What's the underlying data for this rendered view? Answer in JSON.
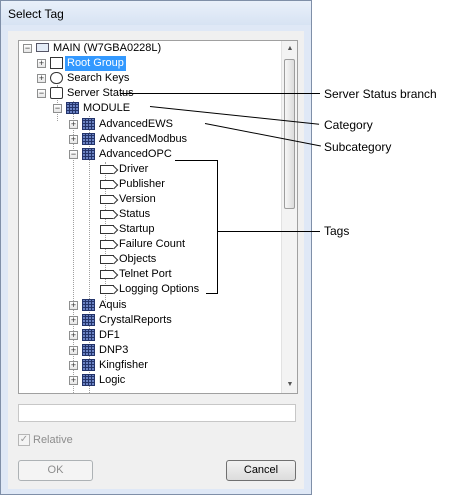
{
  "dialog": {
    "title": "Select Tag",
    "relative_label": "Relative",
    "relative_checked": true,
    "ok_label": "OK",
    "cancel_label": "Cancel"
  },
  "tree": {
    "root": "MAIN (W7GBA0228L)",
    "root_group": "Root Group",
    "search_keys": "Search Keys",
    "server_status": "Server Status",
    "module": "MODULE",
    "advanced_ews": "AdvancedEWS",
    "advanced_modbus": "AdvancedModbus",
    "advanced_opc": "AdvancedOPC",
    "tags": [
      "Driver",
      "Publisher",
      "Version",
      "Status",
      "Startup",
      "Failure Count",
      "Objects",
      "Telnet Port",
      "Logging Options"
    ],
    "modules": [
      "Aquis",
      "CrystalReports",
      "DF1",
      "DNP3",
      "Kingfisher",
      "Logic"
    ]
  },
  "callouts": {
    "server_status_branch": "Server Status branch",
    "category": "Category",
    "subcategory": "Subcategory",
    "tags": "Tags"
  }
}
